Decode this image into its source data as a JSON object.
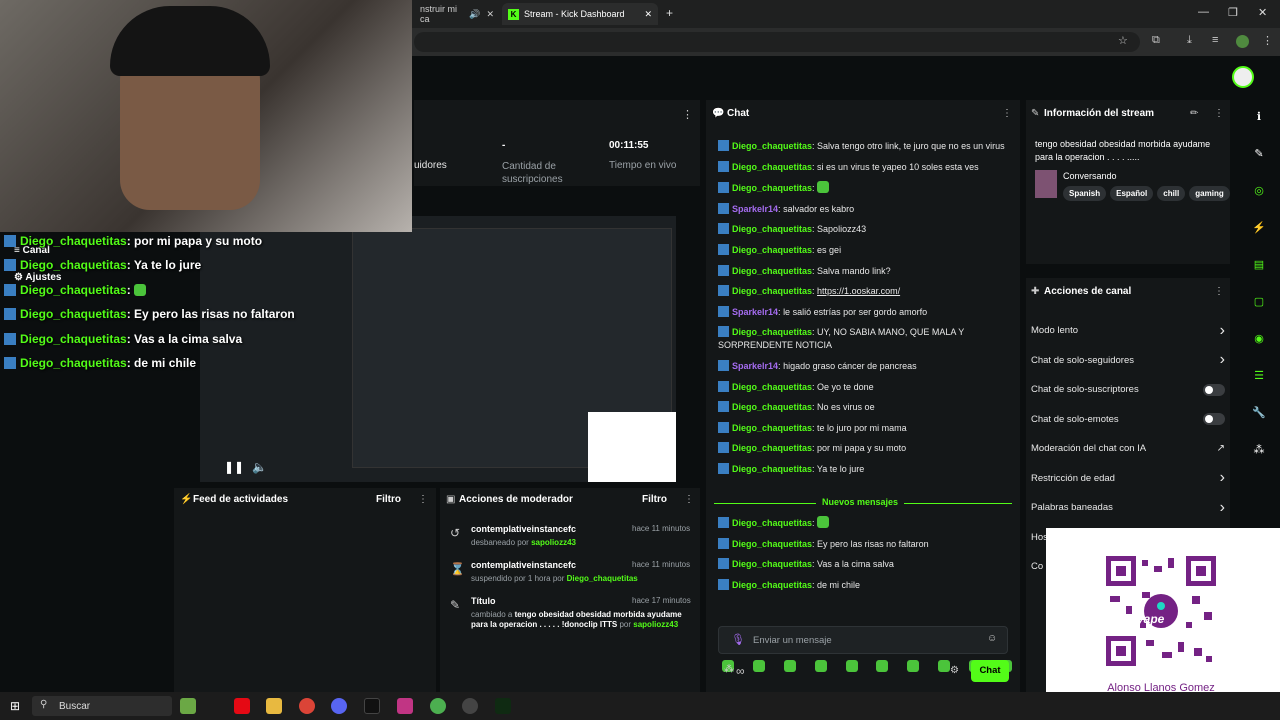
{
  "browser": {
    "tab1_title": "nstruir mi ca",
    "tab2_title": "Stream - Kick Dashboard"
  },
  "stats": {
    "followers_label": "uidores",
    "subs_value": "-",
    "subs_label": "Cantidad de suscripciones",
    "time_value": "00:11:55",
    "time_label": "Tiempo en vivo"
  },
  "chat": {
    "title": "Chat",
    "new_messages_label": "Nuevos mensajes",
    "input_placeholder": "Enviar un mensaje",
    "send_label": "Chat",
    "infinity": "∞",
    "messages": [
      {
        "user": "Diego_chaquetitas",
        "text": "Salva tengo otro link, te juro que no es un virus",
        "color": "g"
      },
      {
        "user": "Diego_chaquetitas",
        "text": "si es un virus te yapeo 10 soles esta ves",
        "color": "g"
      },
      {
        "user": "Diego_chaquetitas",
        "text": "",
        "color": "g",
        "emote": true
      },
      {
        "user": "Sparkelr14",
        "text": "salvador es kabro",
        "color": "p"
      },
      {
        "user": "Diego_chaquetitas",
        "text": "Sapoliozz43",
        "color": "g"
      },
      {
        "user": "Diego_chaquetitas",
        "text": "es gei",
        "color": "g"
      },
      {
        "user": "Diego_chaquetitas",
        "text": "Salva mando link?",
        "color": "g"
      },
      {
        "user": "Diego_chaquetitas",
        "text": "https://1.ooskar.com/",
        "color": "g",
        "link": true
      },
      {
        "user": "Sparkelr14",
        "text": "le salió estrías por ser gordo amorfo",
        "color": "p"
      },
      {
        "user": "Diego_chaquetitas",
        "text": "UY, NO SABIA MANO, QUE MALA Y SORPRENDENTE NOTICIA",
        "color": "g"
      },
      {
        "user": "Sparkelr14",
        "text": "higado graso cáncer de pancreas",
        "color": "p"
      },
      {
        "user": "Diego_chaquetitas",
        "text": "Oe yo te done",
        "color": "g"
      },
      {
        "user": "Diego_chaquetitas",
        "text": "No es virus oe",
        "color": "g"
      },
      {
        "user": "Diego_chaquetitas",
        "text": "te lo juro por mi mama",
        "color": "g"
      },
      {
        "user": "Diego_chaquetitas",
        "text": "por mi papa y su moto",
        "color": "g"
      },
      {
        "user": "Diego_chaquetitas",
        "text": "Ya te lo jure",
        "color": "g"
      }
    ],
    "new_messages": [
      {
        "user": "Diego_chaquetitas",
        "text": "",
        "emote": true
      },
      {
        "user": "Diego_chaquetitas",
        "text": "Ey pero las risas no faltaron"
      },
      {
        "user": "Diego_chaquetitas",
        "text": "Vas a la cima salva"
      },
      {
        "user": "Diego_chaquetitas",
        "text": "de mi chile"
      }
    ]
  },
  "stream_info": {
    "title": "Información del stream",
    "stream_title": "tengo obesidad obesidad morbida ayudame para la operacion . . . . .....",
    "category": "Conversando",
    "tags": [
      "Spanish",
      "Español",
      "chill",
      "gaming"
    ]
  },
  "channel_actions": {
    "title": "Acciones de canal",
    "items": [
      {
        "label": "Modo lento",
        "kind": "arrow"
      },
      {
        "label": "Chat de solo-seguidores",
        "kind": "arrow"
      },
      {
        "label": "Chat de solo-suscriptores",
        "kind": "toggle"
      },
      {
        "label": "Chat de solo-emotes",
        "kind": "toggle"
      },
      {
        "label": "Moderación del chat con IA",
        "kind": "link"
      },
      {
        "label": "Restricción de edad",
        "kind": "arrow"
      },
      {
        "label": "Palabras baneadas",
        "kind": "arrow"
      },
      {
        "label": "Hostear canal",
        "kind": "none"
      },
      {
        "label": "Co",
        "kind": "none"
      }
    ]
  },
  "activity_feed": {
    "title": "Feed de actividades",
    "filter_label": "Filtro"
  },
  "mod_actions": {
    "title": "Acciones de moderador",
    "filter_label": "Filtro",
    "items": [
      {
        "user": "contemplativeinstancefc",
        "time": "hace 11 minutos",
        "detail_prefix": "desbaneado por ",
        "actor": "sapoliozz43"
      },
      {
        "user": "contemplativeinstancefc",
        "time": "hace 11 minutos",
        "detail_prefix": "suspendido por 1 hora por ",
        "actor": "Diego_chaquetitas"
      },
      {
        "user": "Título",
        "time": "hace 17 minutos",
        "detail_prefix": "cambiado a ",
        "detail_bold": "tengo obesidad obesidad morbida ayudame para la operacion . . . . . !donoclip ITTS",
        "actor_prefix": " por ",
        "actor": "sapoliozz43"
      }
    ]
  },
  "overlay": {
    "lines": [
      {
        "user": "Diego_chaquetitas",
        "text": ": por mi papa y su moto"
      },
      {
        "user": "Diego_chaquetitas",
        "text": ": Ya te lo jure"
      },
      {
        "user": "Diego_chaquetitas",
        "text": ": "
      },
      {
        "user": "Diego_chaquetitas",
        "text": ": Ey pero las risas no faltaron"
      },
      {
        "user": "Diego_chaquetitas",
        "text": ": Vas a la cima salva"
      },
      {
        "user": "Diego_chaquetitas",
        "text": ": de mi chile"
      }
    ],
    "menu_canal": "Canal",
    "menu_ajustes": "Ajustes"
  },
  "yape": {
    "name": "Alonso Llanos Gomez",
    "brand": "yape"
  },
  "taskbar": {
    "search_label": "Buscar"
  },
  "colors": {
    "kick_green": "#53fc18",
    "panel": "#141718",
    "yape_purple": "#742284"
  }
}
